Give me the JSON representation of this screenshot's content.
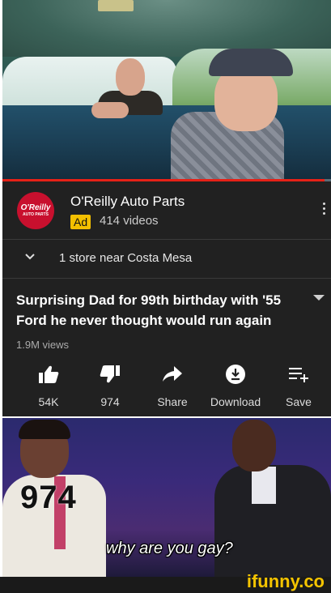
{
  "video": {
    "progress": 0.98,
    "progress_color": "#e62117"
  },
  "channel": {
    "logo_text": "O'Reilly",
    "logo_subtext": "AUTO PARTS",
    "name": "O'Reilly Auto Parts",
    "ad_badge": "Ad",
    "video_count": "414 videos"
  },
  "store": {
    "text": "1 store near Costa Mesa"
  },
  "video_info": {
    "title": "Surprising Dad for 99th birthday with '55 Ford he never thought would run again",
    "views": "1.9M views"
  },
  "actions": [
    {
      "icon": "thumbs-up-icon",
      "label": "54K"
    },
    {
      "icon": "thumbs-down-icon",
      "label": "974"
    },
    {
      "icon": "share-icon",
      "label": "Share"
    },
    {
      "icon": "download-icon",
      "label": "Download"
    },
    {
      "icon": "save-playlist-icon",
      "label": "Save"
    }
  ],
  "meme": {
    "number": "974",
    "caption": "why are you gay?"
  },
  "watermark": "ifunny.co",
  "colors": {
    "panel_bg": "#212121",
    "ad_yellow": "#f3c000",
    "brand_red": "#c8102e"
  }
}
